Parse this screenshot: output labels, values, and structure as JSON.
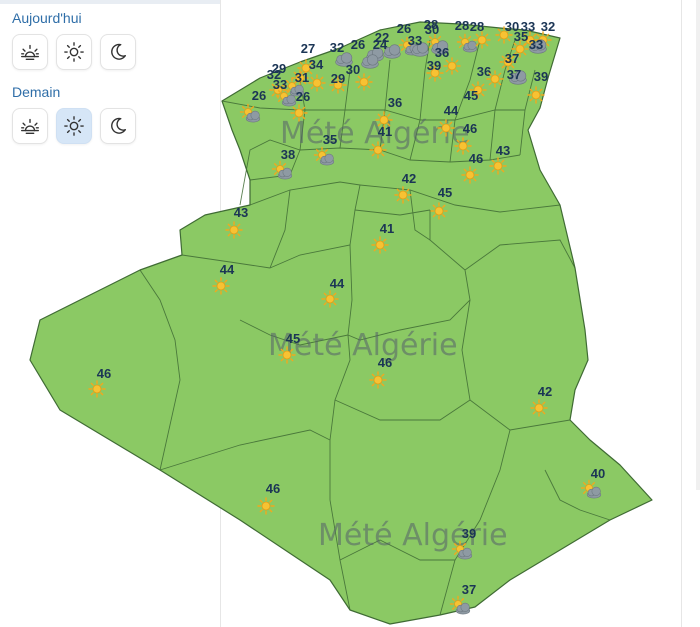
{
  "controls": {
    "today_label": "Aujourd'hui",
    "tomorrow_label": "Demain",
    "today_buttons": [
      {
        "icon": "sunrise-icon",
        "selected": false
      },
      {
        "icon": "sun-icon",
        "selected": false
      },
      {
        "icon": "moon-icon",
        "selected": false
      }
    ],
    "tomorrow_buttons": [
      {
        "icon": "sunrise-icon",
        "selected": false
      },
      {
        "icon": "sun-icon",
        "selected": true
      },
      {
        "icon": "moon-icon",
        "selected": false
      }
    ]
  },
  "map": {
    "country": "Algérie",
    "watermark_text": "Mété Algérie",
    "land_color": "#8bc964",
    "border_color": "#3f6b34",
    "temperature_color": "#1b3555"
  },
  "forecasts": [
    {
      "temp": "26",
      "icon": "sun-cloud-icon"
    },
    {
      "temp": "28",
      "icon": "sun-cloud-icon"
    },
    {
      "temp": "30",
      "icon": "cloud-icon"
    },
    {
      "temp": "28",
      "icon": "sun-cloud-icon"
    },
    {
      "temp": "28",
      "icon": "sun-icon"
    },
    {
      "temp": "22",
      "icon": "cloud-icon"
    },
    {
      "temp": "24",
      "icon": "cloud-icon"
    },
    {
      "temp": "33",
      "icon": "cloud-icon"
    },
    {
      "temp": "27",
      "icon": "sun-icon"
    },
    {
      "temp": "32",
      "icon": "cloud-icon"
    },
    {
      "temp": "26",
      "icon": "cloud-icon"
    },
    {
      "temp": "30",
      "icon": "sun-icon"
    },
    {
      "temp": "33",
      "icon": "sun-icon"
    },
    {
      "temp": "32",
      "icon": "sun-icon"
    },
    {
      "temp": "33",
      "icon": "cloud-icon"
    },
    {
      "temp": "36",
      "icon": "sun-icon"
    },
    {
      "temp": "35",
      "icon": "sun-icon"
    },
    {
      "temp": "37",
      "icon": "sun-icon"
    },
    {
      "temp": "29",
      "icon": "sun-icon"
    },
    {
      "temp": "34",
      "icon": "sun-icon"
    },
    {
      "temp": "31",
      "icon": "sun-cloud-icon"
    },
    {
      "temp": "32",
      "icon": "sun-icon"
    },
    {
      "temp": "33",
      "icon": "sun-cloud-icon"
    },
    {
      "temp": "29",
      "icon": "sun-icon"
    },
    {
      "temp": "30",
      "icon": "sun-icon"
    },
    {
      "temp": "39",
      "icon": "sun-icon"
    },
    {
      "temp": "36",
      "icon": "cloud-icon"
    },
    {
      "temp": "37",
      "icon": "sun-icon"
    },
    {
      "temp": "39",
      "icon": "sun-icon"
    },
    {
      "temp": "26",
      "icon": "sun-cloud-icon"
    },
    {
      "temp": "26",
      "icon": "sun-icon"
    },
    {
      "temp": "36",
      "icon": "sun-icon"
    },
    {
      "temp": "45",
      "icon": "sun-icon"
    },
    {
      "temp": "44",
      "icon": "sun-icon"
    },
    {
      "temp": "41",
      "icon": "sun-icon"
    },
    {
      "temp": "46",
      "icon": "sun-icon"
    },
    {
      "temp": "43",
      "icon": "sun-icon"
    },
    {
      "temp": "46",
      "icon": "sun-icon"
    },
    {
      "temp": "38",
      "icon": "sun-cloud-icon"
    },
    {
      "temp": "35",
      "icon": "sun-cloud-icon"
    },
    {
      "temp": "42",
      "icon": "sun-icon"
    },
    {
      "temp": "45",
      "icon": "sun-icon"
    },
    {
      "temp": "43",
      "icon": "sun-icon"
    },
    {
      "temp": "41",
      "icon": "sun-icon"
    },
    {
      "temp": "44",
      "icon": "sun-icon"
    },
    {
      "temp": "44",
      "icon": "sun-icon"
    },
    {
      "temp": "45",
      "icon": "sun-icon"
    },
    {
      "temp": "46",
      "icon": "sun-icon"
    },
    {
      "temp": "46",
      "icon": "sun-icon"
    },
    {
      "temp": "42",
      "icon": "sun-icon"
    },
    {
      "temp": "40",
      "icon": "sun-cloud-icon"
    },
    {
      "temp": "46",
      "icon": "sun-icon"
    },
    {
      "temp": "39",
      "icon": "sun-cloud-icon"
    },
    {
      "temp": "37",
      "icon": "sun-cloud-icon"
    }
  ]
}
